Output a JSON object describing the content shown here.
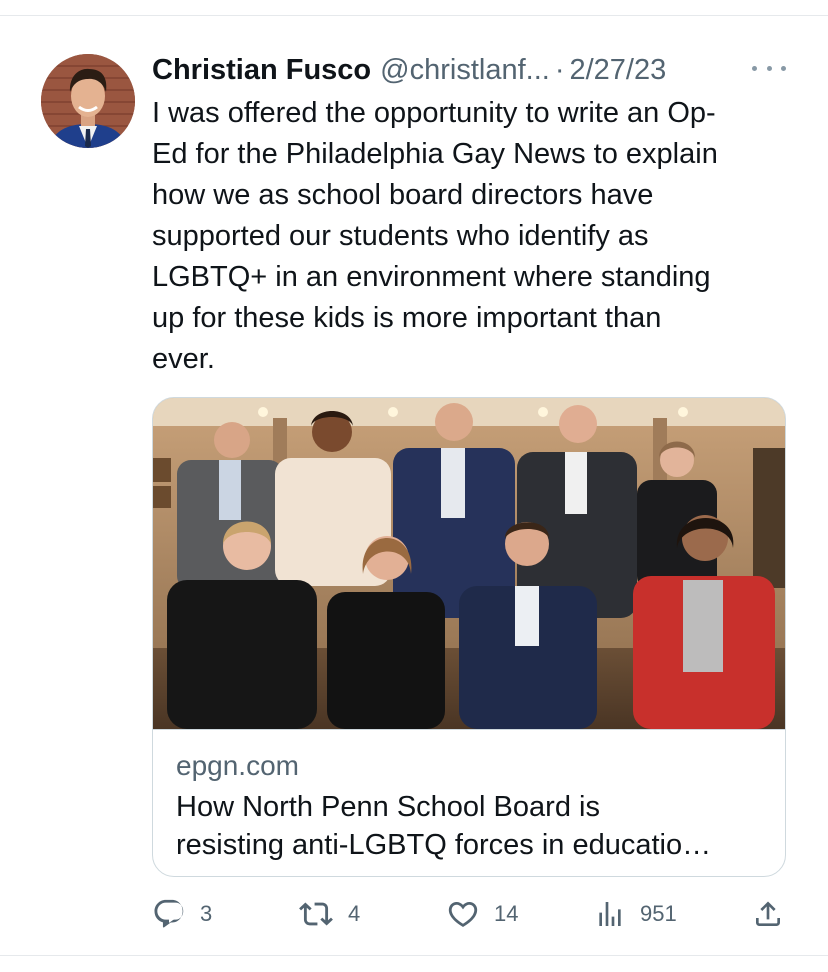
{
  "tweet": {
    "author_name": "Christian Fusco",
    "handle": "@christlanf...",
    "separator": "·",
    "date": "2/27/23",
    "text": "I was offered the opportunity to write an Op-\nEd for the Philadelphia Gay News to explain\nhow we as school board directors have\nsupported our students who identify as\nLGBTQ+ in an environment where standing\nup for these kids is more important than\never."
  },
  "card": {
    "domain": "epgn.com",
    "title": "How North Penn School Board is\nresisting anti-LGBTQ forces in educatio…"
  },
  "actions": {
    "replies": "3",
    "retweets": "4",
    "likes": "14",
    "views": "951"
  },
  "icons": {
    "more": "more-icon",
    "reply": "reply-icon",
    "retweet": "retweet-icon",
    "like": "heart-icon",
    "views": "views-icon",
    "share": "share-icon"
  },
  "colors": {
    "text_primary": "#0f1419",
    "text_secondary": "#536471",
    "border": "#cfd9de"
  }
}
